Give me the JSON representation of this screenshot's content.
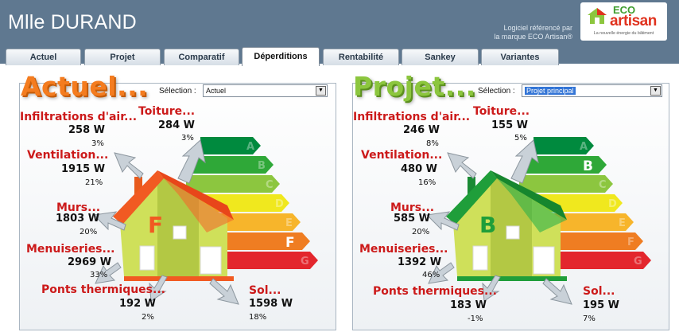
{
  "header": {
    "title": "Mlle DURAND",
    "subtitle_line1": "Logiciel référencé par",
    "subtitle_line2": "la marque ECO Artisan®"
  },
  "logo": {
    "eco": "ECO",
    "artisan": "artisan",
    "tagline": "La nouvelle énergie du bâtiment"
  },
  "tabs": [
    {
      "label": "Actuel",
      "active": false
    },
    {
      "label": "Projet",
      "active": false
    },
    {
      "label": "Comparatif",
      "active": false
    },
    {
      "label": "Déperditions",
      "active": true
    },
    {
      "label": "Rentabilité",
      "active": false
    },
    {
      "label": "Sankey",
      "active": false
    },
    {
      "label": "Variantes",
      "active": false
    }
  ],
  "panels": {
    "left": {
      "title": "Actuel...",
      "selection_label": "Sélection :",
      "selection_value": "Actuel",
      "energy_class": "F",
      "items": {
        "infiltrations": {
          "label": "Infiltrations d'air...",
          "value": "258 W",
          "percent": "3%"
        },
        "toiture": {
          "label": "Toiture...",
          "value": "284 W",
          "percent": "3%"
        },
        "ventilation": {
          "label": "Ventilation...",
          "value": "1915 W",
          "percent": "21%"
        },
        "murs": {
          "label": "Murs...",
          "value": "1803 W",
          "percent": "20%"
        },
        "menuiseries": {
          "label": "Menuiseries...",
          "value": "2969 W",
          "percent": "33%"
        },
        "ponts": {
          "label": "Ponts thermiques...",
          "value": "192 W",
          "percent": "2%"
        },
        "sol": {
          "label": "Sol...",
          "value": "1598 W",
          "percent": "18%"
        }
      }
    },
    "right": {
      "title": "Projet...",
      "selection_label": "Sélection :",
      "selection_value": "Projet principal",
      "energy_class": "B",
      "items": {
        "infiltrations": {
          "label": "Infiltrations d'air...",
          "value": "246 W",
          "percent": "8%"
        },
        "toiture": {
          "label": "Toiture...",
          "value": "155 W",
          "percent": "5%"
        },
        "ventilation": {
          "label": "Ventilation...",
          "value": "480 W",
          "percent": "16%"
        },
        "murs": {
          "label": "Murs...",
          "value": "585 W",
          "percent": "20%"
        },
        "menuiseries": {
          "label": "Menuiseries...",
          "value": "1392 W",
          "percent": "46%"
        },
        "ponts": {
          "label": "Ponts thermiques...",
          "value": "183 W",
          "percent": "-1%"
        },
        "sol": {
          "label": "Sol...",
          "value": "195 W",
          "percent": "7%"
        }
      }
    }
  },
  "energy_scale": {
    "letters": [
      "A",
      "B",
      "C",
      "D",
      "E",
      "F",
      "G"
    ],
    "colors": [
      "#008a3e",
      "#2fa838",
      "#8cc63f",
      "#f0e81e",
      "#f7b52b",
      "#ef7d22",
      "#e3262d"
    ]
  },
  "colors": {
    "header_bg": "#5f7890",
    "title_orange": "#f47c1f",
    "title_green": "#8cc63e",
    "label_red": "#cc1a1a",
    "roof_current": "#f15a22",
    "roof_project": "#1f9e3a",
    "selection_highlight": "#3375d6"
  }
}
